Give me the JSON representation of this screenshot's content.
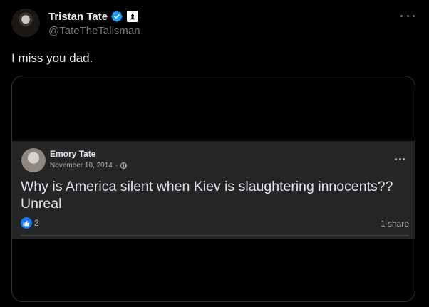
{
  "tweet": {
    "author": {
      "display_name": "Tristan Tate",
      "handle": "@TateTheTalisman",
      "verified_color": "#1d9bf0",
      "affiliation_badge_icon": "chess-piece-icon"
    },
    "text": "I miss you dad.",
    "more_icon": "more-horizontal-icon"
  },
  "embedded_post": {
    "author_name": "Emory Tate",
    "date": "November 10, 2014",
    "separator": "·",
    "audience_icon": "globe-icon",
    "text": "Why is America silent when Kiev is slaughtering innocents?? Unreal",
    "like_count": "2",
    "shares": "1 share",
    "like_color": "#1877f2"
  }
}
